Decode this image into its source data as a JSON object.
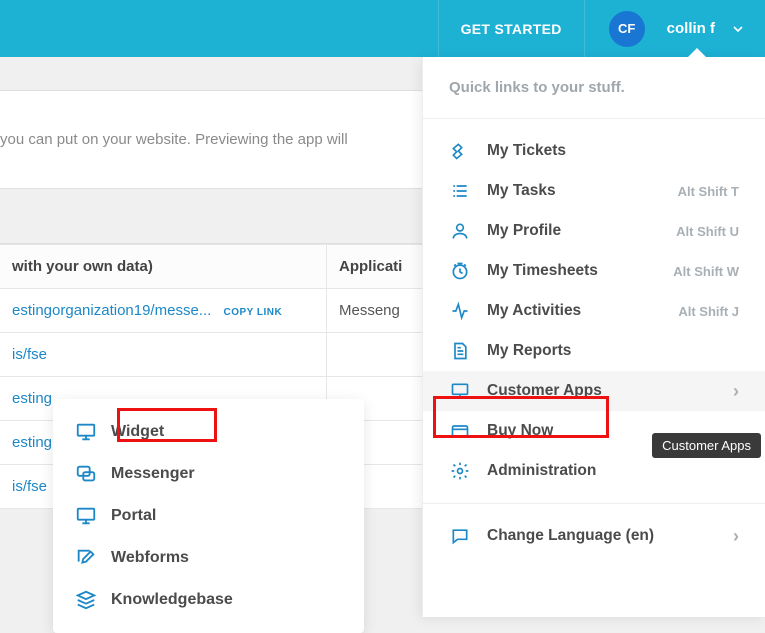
{
  "topbar": {
    "get_started": "GET STARTED",
    "avatar_initials": "CF",
    "user_name": "collin f"
  },
  "content": {
    "description": "you can put on your website. Previewing the app will"
  },
  "table": {
    "header_col1": "with your own data)",
    "header_col2": "Applicati",
    "rows": [
      {
        "link": "estingorganization19/mess",
        "copy": "COPY LINK",
        "app": "Messeng"
      },
      {
        "link": "is/fse"
      },
      {
        "link": "esting"
      },
      {
        "link": "esting"
      },
      {
        "link": "is/fse"
      }
    ]
  },
  "left_popover": {
    "items": [
      {
        "name": "widget",
        "label": "Widget"
      },
      {
        "name": "messenger",
        "label": "Messenger"
      },
      {
        "name": "portal",
        "label": "Portal"
      },
      {
        "name": "webforms",
        "label": "Webforms"
      },
      {
        "name": "knowledgebase",
        "label": "Knowledgebase"
      }
    ]
  },
  "right_panel": {
    "header": "Quick links to your stuff.",
    "items": [
      {
        "name": "my-tickets",
        "label": "My Tickets",
        "shortcut": ""
      },
      {
        "name": "my-tasks",
        "label": "My Tasks",
        "shortcut": "Alt Shift T"
      },
      {
        "name": "my-profile",
        "label": "My Profile",
        "shortcut": "Alt Shift U"
      },
      {
        "name": "my-timesheets",
        "label": "My Timesheets",
        "shortcut": "Alt Shift W"
      },
      {
        "name": "my-activities",
        "label": "My Activities",
        "shortcut": "Alt Shift J"
      },
      {
        "name": "my-reports",
        "label": "My Reports",
        "shortcut": ""
      },
      {
        "name": "customer-apps",
        "label": "Customer Apps",
        "is_highlighted": true,
        "has_chevron": true
      },
      {
        "name": "buy-now",
        "label": "Buy Now"
      },
      {
        "name": "administration",
        "label": "Administration"
      }
    ],
    "lang_item": {
      "label": "Change Language (en)"
    },
    "tooltip": "Customer Apps"
  },
  "colors": {
    "accent": "#1db1d4",
    "link": "#1c88c7",
    "red": "#e11"
  }
}
